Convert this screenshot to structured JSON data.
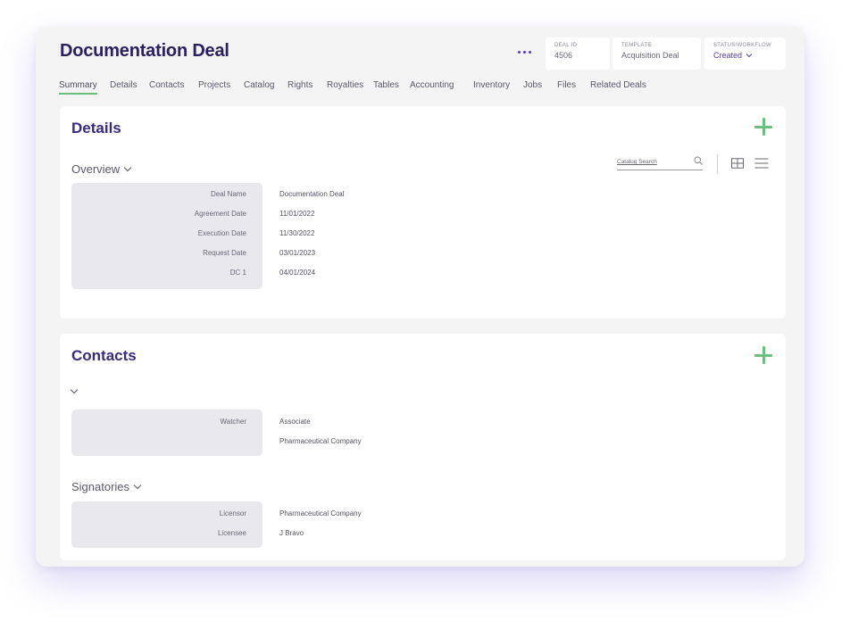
{
  "header": {
    "title": "Documentation Deal",
    "deal_id_label": "DEAL ID",
    "deal_id": "4506",
    "template_label": "TEMPLATE",
    "template": "Acquisition Deal",
    "status_label": "STATUS/WORKFLOW",
    "status": "Created"
  },
  "tabs": [
    {
      "label": "Summary",
      "active": true
    },
    {
      "label": "Details"
    },
    {
      "label": "Contacts"
    },
    {
      "label": "Projects"
    },
    {
      "label": "Catalog"
    },
    {
      "label": "Rights"
    },
    {
      "label": "Royalties"
    },
    {
      "label": "Tables"
    },
    {
      "label": "Accounting"
    },
    {
      "label": "Inventory"
    },
    {
      "label": "Jobs"
    },
    {
      "label": "Files"
    },
    {
      "label": "Related Deals"
    }
  ],
  "details": {
    "title": "Details",
    "section": "Overview",
    "search_placeholder": "Catalog Search",
    "rows": [
      {
        "label": "Deal Name",
        "value": "Documentation Deal"
      },
      {
        "label": "Agreement Date",
        "value": "11/01/2022"
      },
      {
        "label": "Execution Date",
        "value": "11/30/2022"
      },
      {
        "label": "Request Date",
        "value": "03/01/2023"
      },
      {
        "label": "DC 1",
        "value": "04/01/2024"
      }
    ]
  },
  "contacts": {
    "title": "Contacts",
    "group1": {
      "rows": [
        {
          "label": "Watcher",
          "value": "Associate"
        },
        {
          "label": "",
          "value": "Pharmaceutical Company"
        }
      ]
    },
    "signatories": {
      "title": "Signatories",
      "rows": [
        {
          "label": "Licensor",
          "value": "Pharmaceutical Company"
        },
        {
          "label": "Licensee",
          "value": "J Bravo"
        }
      ]
    }
  },
  "colors": {
    "title": "#2c2060",
    "accent": "#5a3fa8",
    "add": "#6ac07c",
    "active_tab_underline": "#69c07a",
    "label_panel": "#e9e8ed"
  },
  "icons": [
    "more-icon",
    "chevron-down-icon",
    "plus-icon",
    "search-icon",
    "grid-view-icon",
    "list-view-icon"
  ]
}
